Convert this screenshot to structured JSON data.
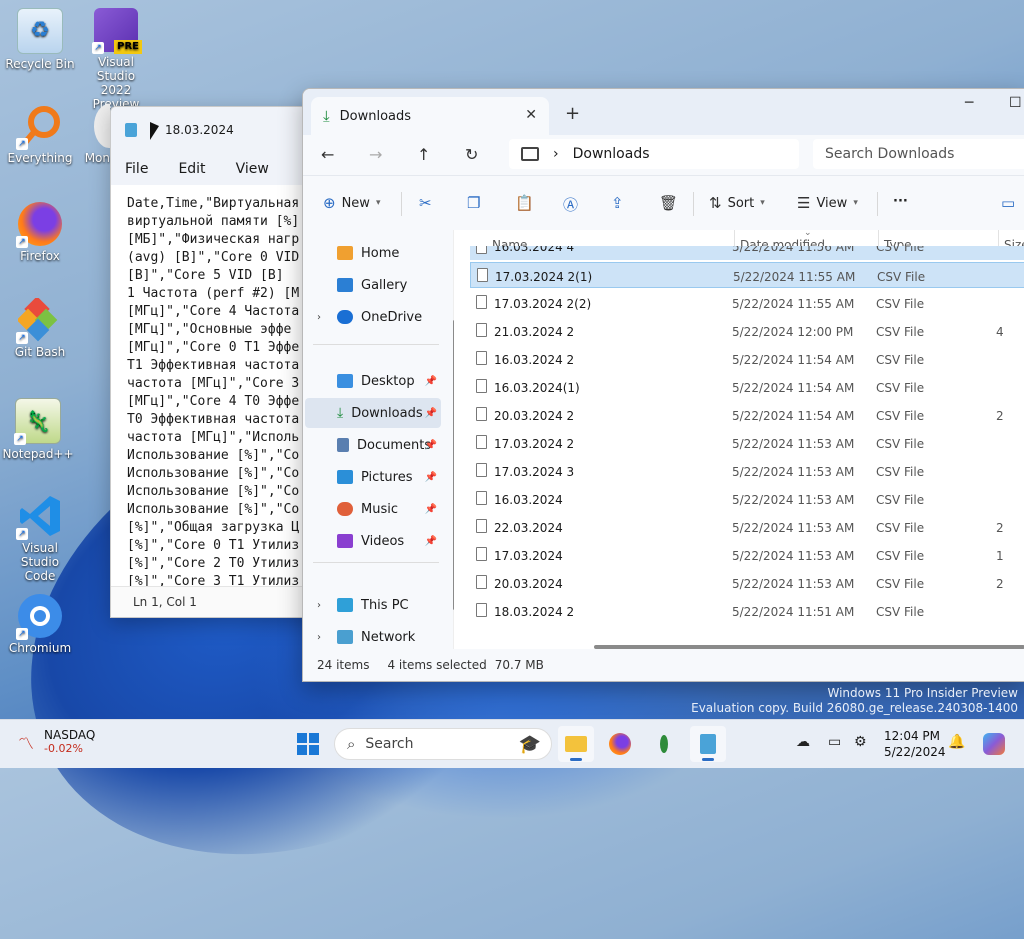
{
  "desktop": {
    "icons": [
      {
        "label": "Recycle Bin"
      },
      {
        "label": "Visual Studio 2022 Preview",
        "badge": "PRE"
      },
      {
        "label": "Everything"
      },
      {
        "label": "Mon"
      },
      {
        "label": "Firefox"
      },
      {
        "label": "Git Bash"
      },
      {
        "label": "Notepad++"
      },
      {
        "label": "Visual Studio Code"
      },
      {
        "label": "Chromium"
      }
    ]
  },
  "notepad": {
    "tab_title": "18.03.2024",
    "menu": [
      "File",
      "Edit",
      "View"
    ],
    "content_lines": [
      "Date,Time,\"Виртуальная",
      "виртуальной памяти [%]",
      "[МБ]\",\"Физическая нагр",
      "(avg) [В]\",\"Core 0 VID",
      "[В]\",\"Core 5 VID [В]",
      "1 Частота (perf #2) [М",
      "[МГц]\",\"Core 4 Частота",
      "[МГц]\",\"Основные эффе",
      "[МГц]\",\"Core 0 T1 Эффе",
      "T1 Эффективная частота",
      "частота [МГц]\",\"Core 3",
      "[МГц]\",\"Core 4 T0 Эффе",
      "T0 Эффективная частота",
      "частота [МГц]\",\"Исполь",
      "Использование [%]\",\"Co",
      "Использование [%]\",\"Co",
      "Использование [%]\",\"Co",
      "Использование [%]\",\"Co",
      "[%]\",\"Общая загрузка Ц",
      "[%]\",\"Core 0 T1 Утилиз",
      "[%]\",\"Core 2 T0 Утилиз",
      "[%]\",\"Core 3 T1 Утилиз"
    ],
    "status": "Ln 1, Col 1"
  },
  "explorer": {
    "tab_title": "Downloads",
    "address": "Downloads",
    "search_placeholder": "Search Downloads",
    "commands": {
      "new": "New",
      "sort": "Sort",
      "view": "View",
      "more": "···"
    },
    "sidebar": [
      {
        "label": "Home"
      },
      {
        "label": "Gallery"
      },
      {
        "label": "OneDrive"
      },
      {
        "label": "Desktop"
      },
      {
        "label": "Downloads"
      },
      {
        "label": "Documents"
      },
      {
        "label": "Pictures"
      },
      {
        "label": "Music"
      },
      {
        "label": "Videos"
      },
      {
        "label": "This PC"
      },
      {
        "label": "Network"
      }
    ],
    "columns": [
      "Name",
      "Date modified",
      "Type",
      "Size"
    ],
    "rows": [
      {
        "name": "16.03.2024 4",
        "date": "5/22/2024 11:56 AM",
        "type": "CSV File",
        "size": "",
        "selected": true
      },
      {
        "name": "17.03.2024 2(1)",
        "date": "5/22/2024 11:55 AM",
        "type": "CSV File",
        "size": "",
        "selected": true
      },
      {
        "name": "17.03.2024 2(2)",
        "date": "5/22/2024 11:55 AM",
        "type": "CSV File",
        "size": ""
      },
      {
        "name": "21.03.2024 2",
        "date": "5/22/2024 12:00 PM",
        "type": "CSV File",
        "size": "4"
      },
      {
        "name": "16.03.2024 2",
        "date": "5/22/2024 11:54 AM",
        "type": "CSV File",
        "size": ""
      },
      {
        "name": "16.03.2024(1)",
        "date": "5/22/2024 11:54 AM",
        "type": "CSV File",
        "size": ""
      },
      {
        "name": "20.03.2024 2",
        "date": "5/22/2024 11:54 AM",
        "type": "CSV File",
        "size": "2"
      },
      {
        "name": "17.03.2024 2",
        "date": "5/22/2024 11:53 AM",
        "type": "CSV File",
        "size": ""
      },
      {
        "name": "17.03.2024 3",
        "date": "5/22/2024 11:53 AM",
        "type": "CSV File",
        "size": ""
      },
      {
        "name": "16.03.2024",
        "date": "5/22/2024 11:53 AM",
        "type": "CSV File",
        "size": ""
      },
      {
        "name": "22.03.2024",
        "date": "5/22/2024 11:53 AM",
        "type": "CSV File",
        "size": "2"
      },
      {
        "name": "17.03.2024",
        "date": "5/22/2024 11:53 AM",
        "type": "CSV File",
        "size": "1"
      },
      {
        "name": "20.03.2024",
        "date": "5/22/2024 11:53 AM",
        "type": "CSV File",
        "size": "2"
      },
      {
        "name": "18.03.2024 2",
        "date": "5/22/2024 11:51 AM",
        "type": "CSV File",
        "size": ""
      }
    ],
    "status": {
      "items": "24 items",
      "selected": "4 items selected",
      "size": "70.7 MB"
    }
  },
  "watermark": {
    "line1": "Windows 11 Pro Insider Preview",
    "line2": "Evaluation copy. Build 26080.ge_release.240308-1400"
  },
  "taskbar": {
    "stock_name": "NASDAQ",
    "stock_change": "-0.02%",
    "search_placeholder": "Search",
    "time": "12:04 PM",
    "date": "5/22/2024"
  }
}
